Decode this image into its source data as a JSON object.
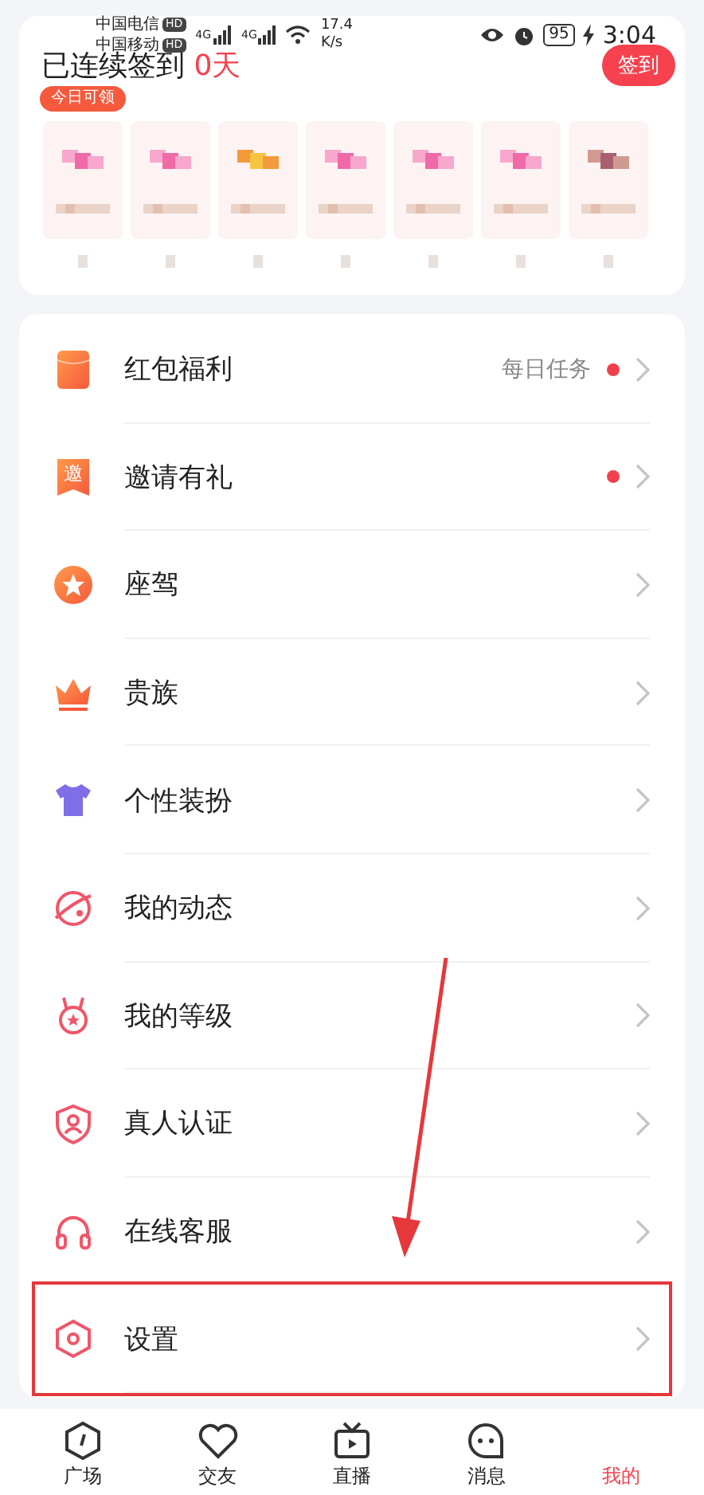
{
  "status_bar": {
    "carriers": [
      {
        "name": "中国电信",
        "badge": "HD"
      },
      {
        "name": "中国移动",
        "badge": "HD"
      }
    ],
    "networks": [
      "4G",
      "4G"
    ],
    "speed": "17.4",
    "speed_unit": "K/s",
    "battery": "95",
    "charging": true,
    "time": "3:04"
  },
  "checkin": {
    "label": "已连续签到",
    "days": "0天",
    "button": "签到",
    "tag": "今日可领"
  },
  "menu": [
    {
      "kind": "red-packet",
      "label": "红包福利",
      "note": "每日任务",
      "dot": true,
      "highlighted": false
    },
    {
      "kind": "invite",
      "label": "邀请有礼",
      "badge": "邀",
      "dot": true,
      "highlighted": false
    },
    {
      "kind": "star",
      "label": "座驾",
      "dot": false,
      "highlighted": false
    },
    {
      "kind": "crown",
      "label": "贵族",
      "dot": false,
      "highlighted": false
    },
    {
      "kind": "shirt",
      "label": "个性装扮",
      "dot": false,
      "highlighted": false
    },
    {
      "kind": "planet",
      "label": "我的动态",
      "dot": false,
      "highlighted": false
    },
    {
      "kind": "medal",
      "label": "我的等级",
      "dot": false,
      "highlighted": false
    },
    {
      "kind": "shield",
      "label": "真人认证",
      "dot": false,
      "highlighted": false
    },
    {
      "kind": "headset",
      "label": "在线客服",
      "dot": false,
      "highlighted": false
    },
    {
      "kind": "gear",
      "label": "设置",
      "dot": false,
      "highlighted": true
    }
  ],
  "annotation": {
    "kind": "arrow"
  },
  "tabs": [
    {
      "kind": "hexagon",
      "label": "广场",
      "selected": false
    },
    {
      "kind": "heart",
      "label": "交友",
      "selected": false
    },
    {
      "kind": "tv",
      "label": "直播",
      "selected": false
    },
    {
      "kind": "chat",
      "label": "消息",
      "selected": false
    },
    {
      "kind": "none",
      "label": "我的",
      "selected": true
    }
  ]
}
